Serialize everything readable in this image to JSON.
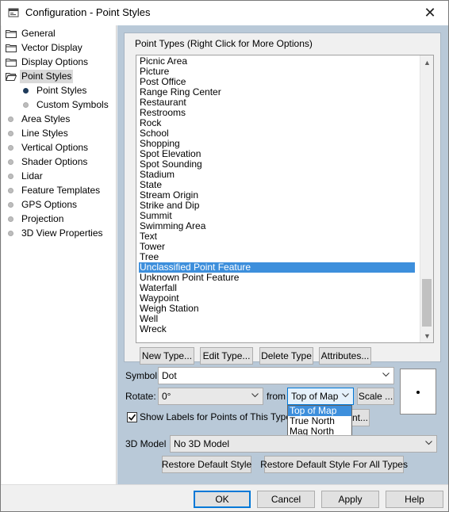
{
  "window": {
    "title": "Configuration - Point Styles",
    "close_glyph": "✕"
  },
  "tree": {
    "items": [
      {
        "label": "General",
        "icon": "folder-icon"
      },
      {
        "label": "Vector Display",
        "icon": "folder-icon"
      },
      {
        "label": "Display Options",
        "icon": "folder-icon"
      },
      {
        "label": "Point Styles",
        "icon": "folder-open-icon",
        "selected": true
      },
      {
        "label": "Point Styles",
        "icon": "bullet-icon",
        "child": true,
        "active": true
      },
      {
        "label": "Custom Symbols",
        "icon": "bullet-icon",
        "child": true
      },
      {
        "label": "Area Styles",
        "icon": "bullet-icon"
      },
      {
        "label": "Line Styles",
        "icon": "bullet-icon"
      },
      {
        "label": "Vertical Options",
        "icon": "bullet-icon"
      },
      {
        "label": "Shader Options",
        "icon": "bullet-icon"
      },
      {
        "label": "Lidar",
        "icon": "bullet-icon"
      },
      {
        "label": "Feature Templates",
        "icon": "bullet-icon"
      },
      {
        "label": "GPS Options",
        "icon": "bullet-icon"
      },
      {
        "label": "Projection",
        "icon": "bullet-icon"
      },
      {
        "label": "3D View Properties",
        "icon": "bullet-icon"
      }
    ]
  },
  "point_types": {
    "legend": "Point Types (Right Click for More Options)",
    "items": [
      "Picnic Area",
      "Picture",
      "Post Office",
      "Range Ring Center",
      "Restaurant",
      "Restrooms",
      "Rock",
      "School",
      "Shopping",
      "Spot Elevation",
      "Spot Sounding",
      "Stadium",
      "State",
      "Stream Origin",
      "Strike and Dip",
      "Summit",
      "Swimming Area",
      "Text",
      "Tower",
      "Tree",
      "Unclassified Point Feature",
      "Unknown Point Feature",
      "Waterfall",
      "Waypoint",
      "Weigh Station",
      "Well",
      "Wreck"
    ],
    "selected_index": 20,
    "buttons": {
      "new": "New Type...",
      "edit": "Edit Type...",
      "delete": "Delete Type",
      "attributes": "Attributes..."
    }
  },
  "symbol": {
    "label": "Symbol",
    "value": "Dot"
  },
  "rotate": {
    "label": "Rotate:",
    "value": "0°",
    "from_label": "from",
    "from_value": "Top of Map",
    "scale_button": "Scale ...",
    "options": [
      "Top of Map",
      "True North",
      "Mag North"
    ],
    "selected_option": 0
  },
  "show_labels": {
    "label": "Show Labels for Points of This Type",
    "checked": true,
    "font_button_partial": "nt..."
  },
  "model3d": {
    "label": "3D Model",
    "value": "No 3D Model"
  },
  "restore": {
    "default": "Restore Default Style",
    "all": "Restore Default Style For All Types"
  },
  "footer": {
    "ok": "OK",
    "cancel": "Cancel",
    "apply": "Apply",
    "help": "Help"
  },
  "colors": {
    "selection": "#3d8fdc",
    "panel_bg": "#b9c9d8",
    "default_button_border": "#0078d7"
  }
}
